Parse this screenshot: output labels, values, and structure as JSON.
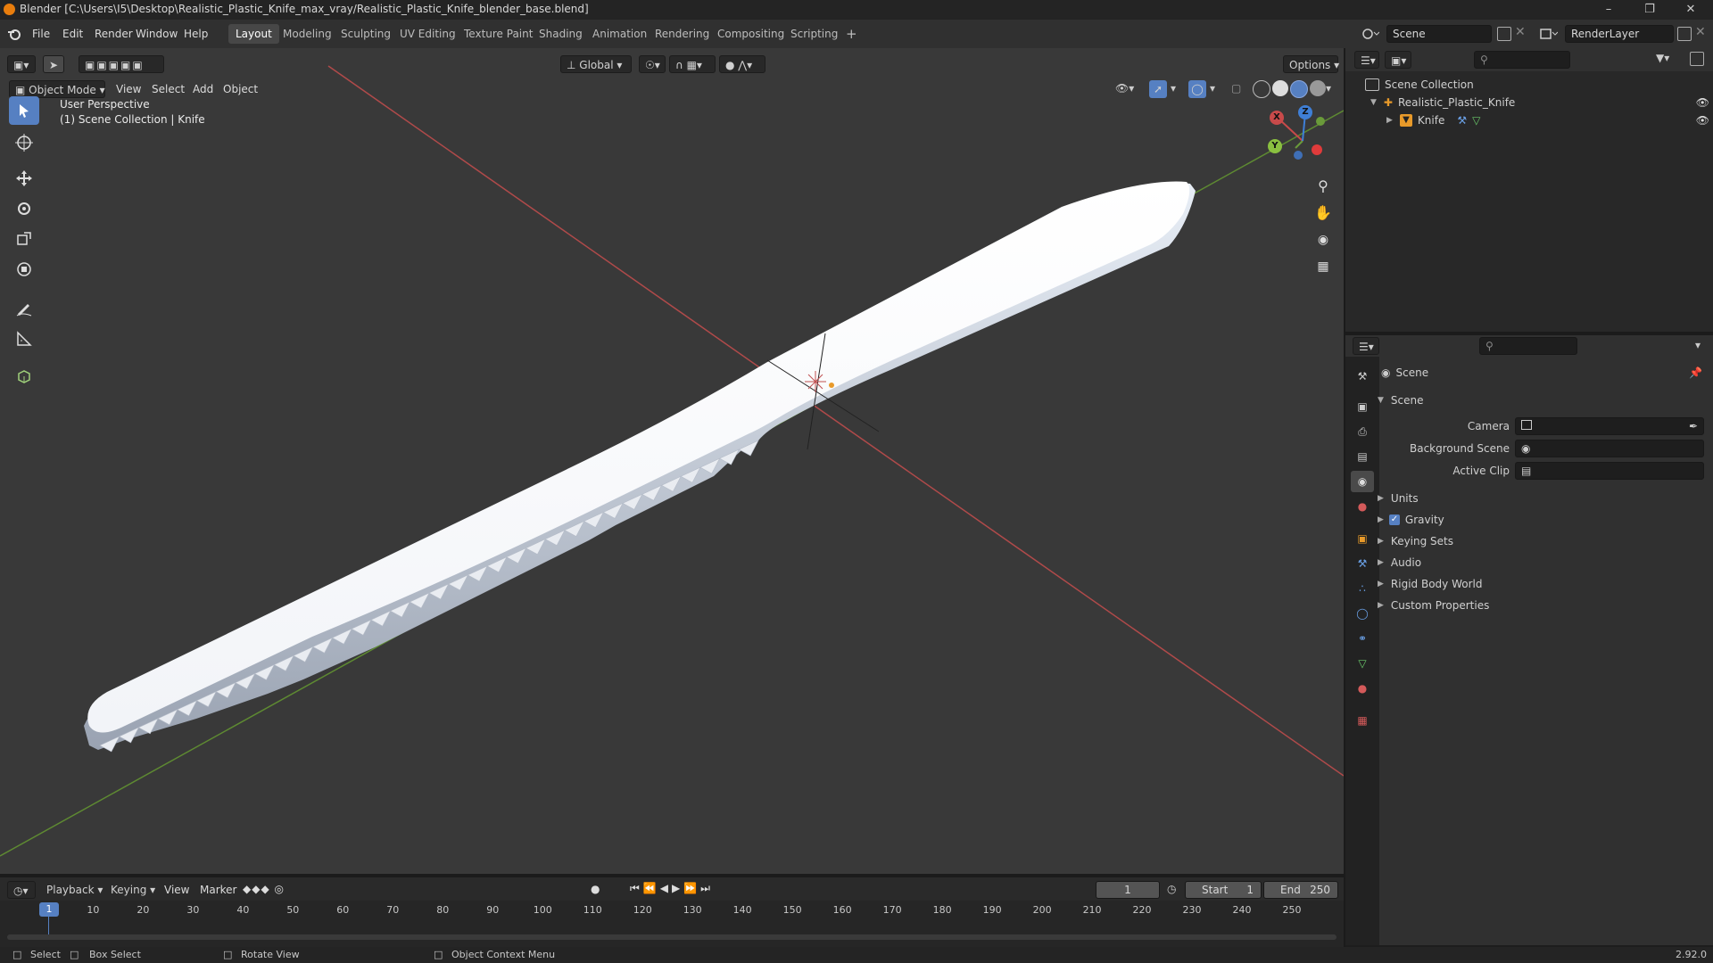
{
  "window": {
    "title": "Blender [C:\\Users\\I5\\Desktop\\Realistic_Plastic_Knife_max_vray/Realistic_Plastic_Knife_blender_base.blend]"
  },
  "menu": [
    "File",
    "Edit",
    "Render",
    "Window",
    "Help"
  ],
  "workspaces": [
    "Layout",
    "Modeling",
    "Sculpting",
    "UV Editing",
    "Texture Paint",
    "Shading",
    "Animation",
    "Rendering",
    "Compositing",
    "Scripting"
  ],
  "active_workspace": "Layout",
  "scene_name": "Scene",
  "view_layer": "RenderLayer",
  "viewport": {
    "mode": "Object Mode",
    "menus": [
      "View",
      "Select",
      "Add",
      "Object"
    ],
    "orientation": "Global",
    "options": "Options",
    "overlay_line1": "User Perspective",
    "overlay_line2": "(1) Scene Collection | Knife",
    "gizmo": {
      "x": "X",
      "y": "Y",
      "z": "Z"
    }
  },
  "outliner": {
    "root": "Scene Collection",
    "items": [
      {
        "name": "Realistic_Plastic_Knife"
      },
      {
        "name": "Knife"
      }
    ]
  },
  "properties": {
    "header": "Scene",
    "panel": "Scene",
    "fields": [
      {
        "label": "Camera",
        "value": ""
      },
      {
        "label": "Background Scene",
        "value": ""
      },
      {
        "label": "Active Clip",
        "value": ""
      }
    ],
    "sections": [
      {
        "name": "Units",
        "checkbox": false
      },
      {
        "name": "Gravity",
        "checkbox": true
      },
      {
        "name": "Keying Sets",
        "checkbox": false
      },
      {
        "name": "Audio",
        "checkbox": false
      },
      {
        "name": "Rigid Body World",
        "checkbox": false
      },
      {
        "name": "Custom Properties",
        "checkbox": false
      }
    ]
  },
  "timeline": {
    "menus": [
      "Playback",
      "Keying",
      "View",
      "Marker"
    ],
    "current_frame": "1",
    "start_label": "Start",
    "start": "1",
    "end_label": "End",
    "end": "250",
    "ticks": [
      "1",
      "10",
      "20",
      "30",
      "40",
      "50",
      "60",
      "70",
      "80",
      "90",
      "100",
      "110",
      "120",
      "130",
      "140",
      "150",
      "160",
      "170",
      "180",
      "190",
      "200",
      "210",
      "220",
      "230",
      "240",
      "250"
    ]
  },
  "statusbar": {
    "select": "Select",
    "box_select": "Box Select",
    "rotate": "Rotate View",
    "context": "Object Context Menu",
    "version": "2.92.0"
  },
  "colors": {
    "accent": "#5680c2",
    "x_axis": "#c84a4a",
    "y_axis": "#6a9a3a",
    "z_axis": "#3f7fd6"
  }
}
